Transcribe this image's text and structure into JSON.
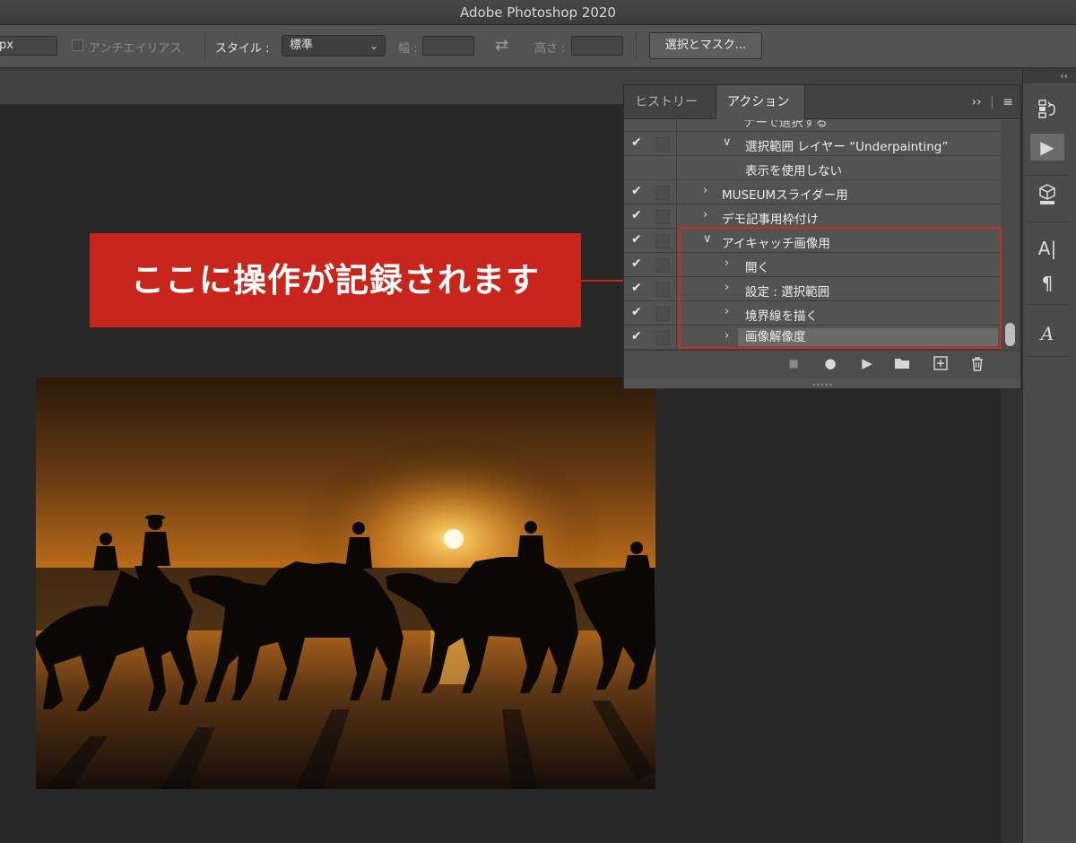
{
  "window": {
    "title": "Adobe Photoshop 2020"
  },
  "options_bar": {
    "mode_value": "px",
    "antialias_label": "アンチエイリアス",
    "style_label": "スタイル :",
    "style_value": "標準",
    "width_label": "幅 :",
    "height_label": "高さ :",
    "select_mask_button": "選択とマスク..."
  },
  "actions_panel": {
    "tabs": [
      {
        "label": "ヒストリー",
        "active": false
      },
      {
        "label": "アクション",
        "active": true
      }
    ],
    "rows": [
      {
        "label": "ナーで選択する",
        "checked": false,
        "arrow": "",
        "partial": true
      },
      {
        "label": "選択範囲 レイヤー “Underpainting”",
        "checked": true,
        "arrow": "down"
      },
      {
        "label": "表示を使用しない",
        "checked": false,
        "arrow": ""
      },
      {
        "label": "MUSEUMスライダー用",
        "checked": true,
        "arrow": "right"
      },
      {
        "label": "デモ記事用枠付け",
        "checked": true,
        "arrow": "right"
      },
      {
        "label": "アイキャッチ画像用",
        "checked": true,
        "arrow": "down"
      },
      {
        "label": "開く",
        "checked": true,
        "arrow": "right"
      },
      {
        "label": "設定 : 選択範囲",
        "checked": true,
        "arrow": "right"
      },
      {
        "label": "境界線を描く",
        "checked": true,
        "arrow": "right"
      },
      {
        "label": "画像解像度",
        "checked": true,
        "arrow": "right",
        "selected": true
      }
    ],
    "footer_buttons": [
      "stop-icon",
      "record-icon",
      "play-icon",
      "folder-icon",
      "new-action-icon",
      "trash-icon"
    ]
  },
  "annotation": {
    "text": "ここに操作が記録されます",
    "color": "#c8251c"
  },
  "colors": {
    "panel_bg": "#535353",
    "canvas_bg": "#282828",
    "highlight_red": "#cf2a22"
  }
}
